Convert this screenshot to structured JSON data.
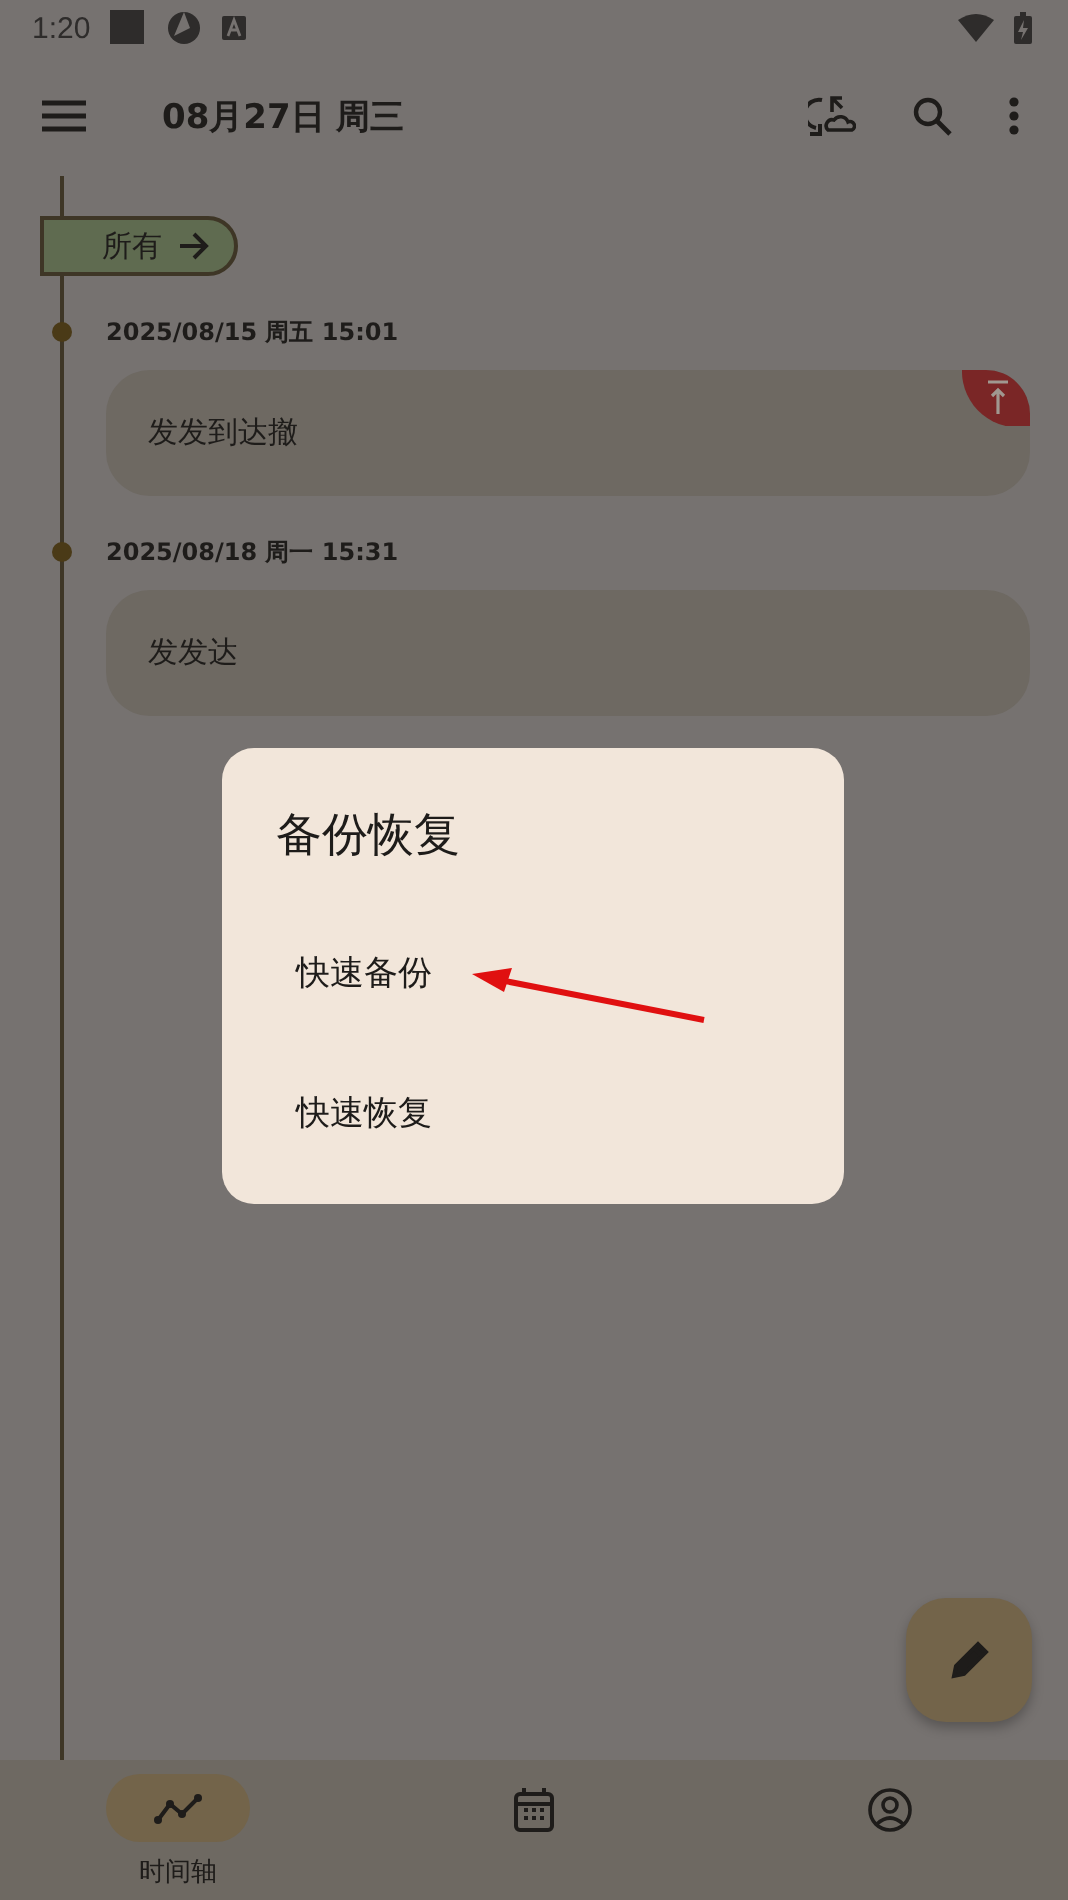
{
  "status_bar": {
    "time": "1:20"
  },
  "app_bar": {
    "title": "08月27日 周三"
  },
  "filter_chip": {
    "label": "所有"
  },
  "entries": [
    {
      "date": "2025/08/15 周五 15:01",
      "text": "发发到达撤",
      "pinned": true
    },
    {
      "date": "2025/08/18 周一 15:31",
      "text": "发发达",
      "pinned": false
    }
  ],
  "dialog": {
    "title": "备份恢复",
    "options": [
      "快速备份",
      "快速恢复"
    ]
  },
  "bottom_nav": [
    {
      "kind": "timeline",
      "label": "时间轴",
      "selected": true
    },
    {
      "kind": "calendar",
      "selected": false
    },
    {
      "kind": "profile",
      "selected": false
    }
  ]
}
